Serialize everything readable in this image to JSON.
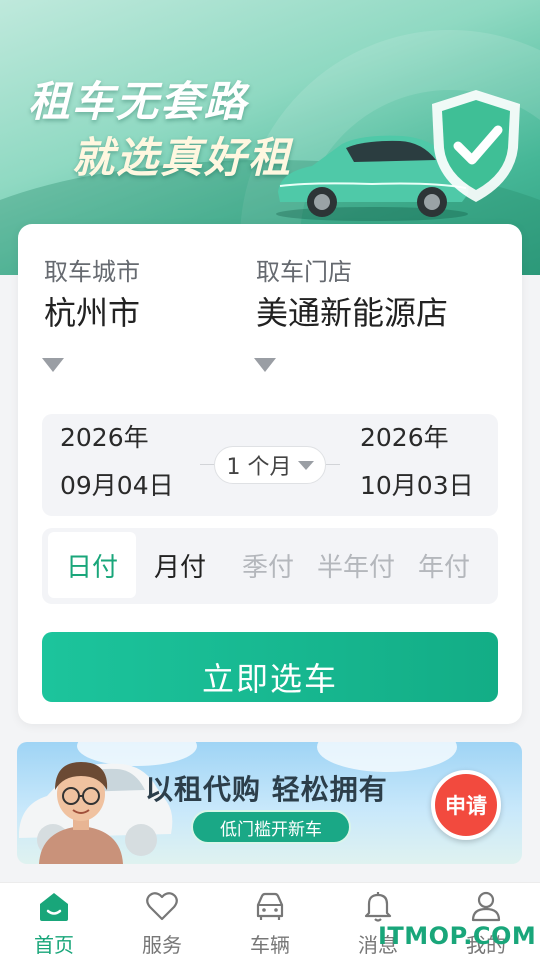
{
  "hero": {
    "title": "租车无套路",
    "subtitle": "就选真好租"
  },
  "pickup": {
    "city_label": "取车城市",
    "city_value": "杭州市",
    "store_label": "取车门店",
    "store_value": "美通新能源店"
  },
  "dates": {
    "start_year": "2026年",
    "start_day": "09月04日",
    "duration": "1 个月",
    "end_year": "2026年",
    "end_day": "10月03日"
  },
  "payment": {
    "options": [
      "日付",
      "月付",
      "季付",
      "半年付",
      "年付"
    ],
    "selected": "日付"
  },
  "cta_label": "立即选车",
  "promo": {
    "title": "以租代购 轻松拥有",
    "pill": "低门槛开新车",
    "apply": "申请"
  },
  "nav": {
    "items": [
      {
        "label": "首页",
        "icon": "home-icon"
      },
      {
        "label": "服务",
        "icon": "heart-icon"
      },
      {
        "label": "车辆",
        "icon": "car-icon"
      },
      {
        "label": "消息",
        "icon": "bell-icon"
      },
      {
        "label": "我的",
        "icon": "user-icon"
      }
    ],
    "active": "首页"
  },
  "watermark": "ITMOP.COM",
  "colors": {
    "accent": "#19a67a",
    "cta_start": "#1cc49c",
    "cta_end": "#13ad86",
    "apply_red": "#f24a3e"
  }
}
